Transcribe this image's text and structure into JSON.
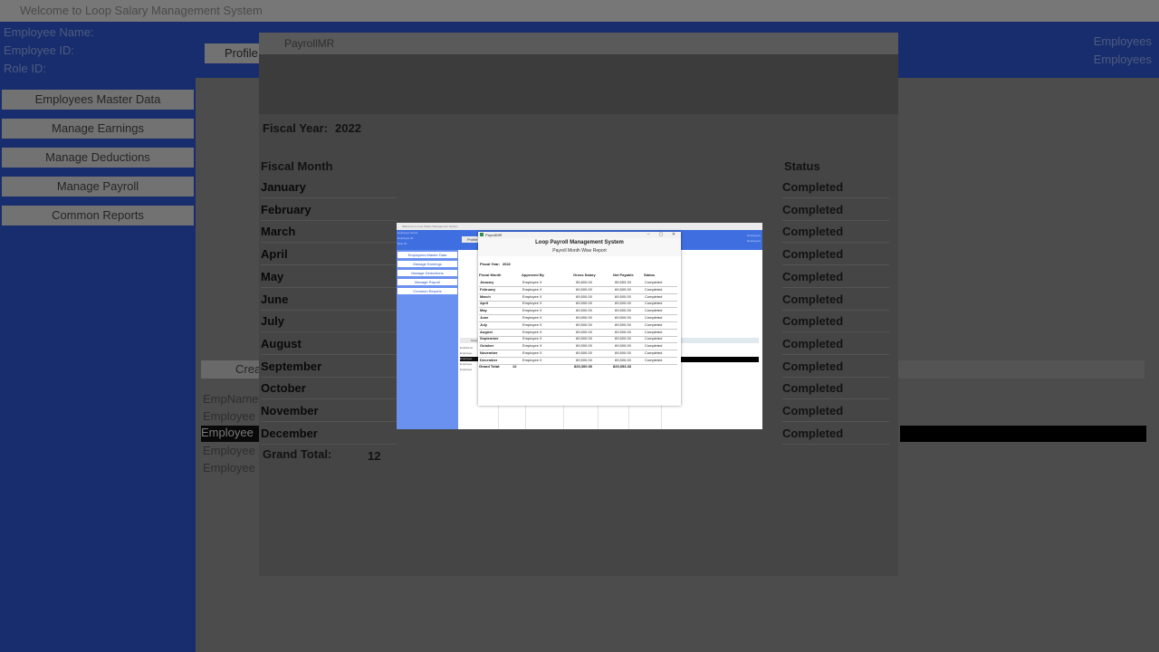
{
  "window_title": "Welcome to Loop Salary Management System",
  "header": {
    "employee_name_label": "Employee Name:",
    "employee_id_label": "Employee ID:",
    "role_id_label": "Role ID:",
    "right_line1": "Employees",
    "right_line2": "Employees"
  },
  "profile_tab": "Profile",
  "sidebar": {
    "items": [
      {
        "label": "Employees Master Data"
      },
      {
        "label": "Manage Earnings"
      },
      {
        "label": "Manage Deductions"
      },
      {
        "label": "Manage Payroll"
      },
      {
        "label": "Common Reports"
      }
    ]
  },
  "background_list": {
    "create_label": "Crea",
    "items": [
      "EmpName",
      "Employee",
      "Employee",
      "Employee",
      "Employee"
    ]
  },
  "dialog": {
    "title": "PayrollMR",
    "report_title": "Loop Payroll Management System",
    "report_subtitle": "Payroll Month Wise Report",
    "fiscal_year_label": "Fiscal Year:",
    "fiscal_year_value": "2022",
    "columns": {
      "month": "Fiscal Month",
      "approved_by": "Approved By",
      "gross": "Gross Salary",
      "net": "Net Payable",
      "status": "Status"
    },
    "rows": [
      {
        "month": "January",
        "approved_by": "Employee X",
        "gross": "55,800.00",
        "net": "55,553.33",
        "status": "Completed"
      },
      {
        "month": "February",
        "approved_by": "Employee X",
        "gross": "69,500.00",
        "net": "69,500.00",
        "status": "Completed"
      },
      {
        "month": "March",
        "approved_by": "Employee X",
        "gross": "69,500.00",
        "net": "69,500.00",
        "status": "Completed"
      },
      {
        "month": "April",
        "approved_by": "Employee X",
        "gross": "69,500.00",
        "net": "69,500.00",
        "status": "Completed"
      },
      {
        "month": "May",
        "approved_by": "Employee X",
        "gross": "69,500.00",
        "net": "69,500.00",
        "status": "Completed"
      },
      {
        "month": "June",
        "approved_by": "Employee X",
        "gross": "69,500.00",
        "net": "69,500.00",
        "status": "Completed"
      },
      {
        "month": "July",
        "approved_by": "Employee X",
        "gross": "69,500.00",
        "net": "69,500.00",
        "status": "Completed"
      },
      {
        "month": "August",
        "approved_by": "Employee X",
        "gross": "69,500.00",
        "net": "69,500.00",
        "status": "Completed"
      },
      {
        "month": "September",
        "approved_by": "Employee X",
        "gross": "69,500.00",
        "net": "69,500.00",
        "status": "Completed"
      },
      {
        "month": "October",
        "approved_by": "Employee X",
        "gross": "69,500.00",
        "net": "69,500.00",
        "status": "Completed"
      },
      {
        "month": "November",
        "approved_by": "Employee X",
        "gross": "69,500.00",
        "net": "69,500.00",
        "status": "Completed"
      },
      {
        "month": "December",
        "approved_by": "Employee X",
        "gross": "69,500.00",
        "net": "69,500.00",
        "status": "Completed"
      }
    ],
    "grand_total_label": "Grand Total:",
    "grand_total_count": "12",
    "grand_total_gross": "820,300.00",
    "grand_total_net": "820,053.33"
  },
  "colors": {
    "header_blue": "#3e6ee0",
    "sidebar_blue": "#6a90f0"
  }
}
